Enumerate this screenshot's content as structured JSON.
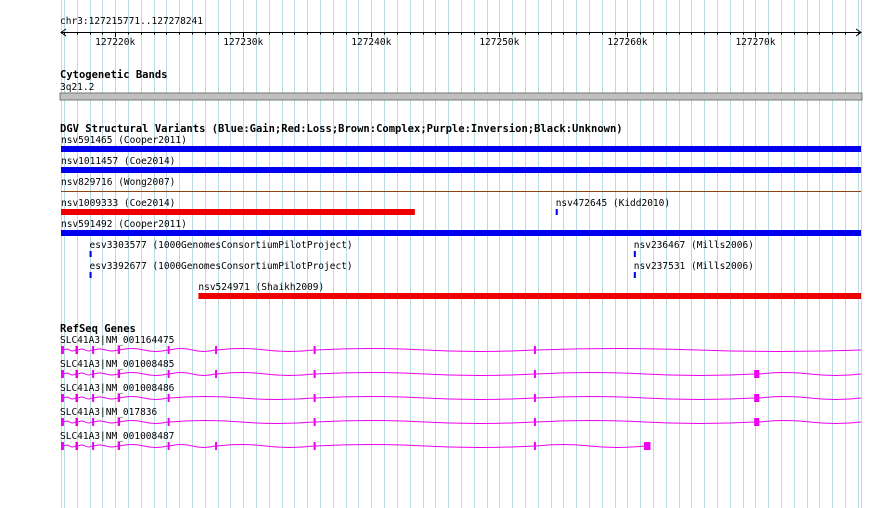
{
  "ruler": {
    "location": "chr3:127215771..127278241",
    "start": 127215771,
    "end": 127278241,
    "tick_labels": [
      "127220k",
      "127230k",
      "127240k",
      "127250k",
      "127260k",
      "127270k"
    ],
    "tick_values": [
      127220000,
      127230000,
      127240000,
      127250000,
      127260000,
      127270000
    ]
  },
  "cytobands": {
    "title": "Cytogenetic Bands",
    "band": "3q21.2"
  },
  "dgv": {
    "title": "DGV Structural Variants (Blue:Gain;Red:Loss;Brown:Complex;Purple:Inversion;Black:Unknown)",
    "colors": {
      "gain": "#0000ee",
      "loss": "#ee0000",
      "complex": "#8b4513",
      "inversion": "#800080",
      "unknown": "#000000"
    },
    "features": [
      {
        "label": "nsv591465 (Cooper2011)",
        "type": "gain",
        "start": 127215771,
        "end": 127278241,
        "row": 0
      },
      {
        "label": "nsv1011457 (Coe2014)",
        "type": "gain",
        "start": 127215771,
        "end": 127278241,
        "row": 1
      },
      {
        "label": "nsv829716 (Wong2007)",
        "type": "complex",
        "start": 127215771,
        "end": 127278241,
        "row": 2
      },
      {
        "label": "nsv1009333 (Coe2014)",
        "type": "loss",
        "start": 127215771,
        "end": 127243400,
        "row": 3
      },
      {
        "label": "nsv472645 (Kidd2010)",
        "type": "gain",
        "start": 127254400,
        "end": 127254560,
        "row": 3
      },
      {
        "label": "nsv591492 (Cooper2011)",
        "type": "gain",
        "start": 127215771,
        "end": 127278241,
        "row": 4
      },
      {
        "label": "esv3303577 (1000GenomesConsortiumPilotProject)",
        "type": "gain",
        "start": 127218000,
        "end": 127218160,
        "row": 5
      },
      {
        "label": "nsv236467 (Mills2006)",
        "type": "gain",
        "start": 127260500,
        "end": 127260660,
        "row": 5
      },
      {
        "label": "esv3392677 (1000GenomesConsortiumPilotProject)",
        "type": "gain",
        "start": 127218000,
        "end": 127218160,
        "row": 6
      },
      {
        "label": "nsv237531 (Mills2006)",
        "type": "gain",
        "start": 127260500,
        "end": 127260660,
        "row": 6
      },
      {
        "label": "nsv524971 (Shaikh2009)",
        "type": "loss",
        "start": 127226500,
        "end": 127278241,
        "row": 7
      }
    ]
  },
  "refseq": {
    "title": "RefSeq Genes",
    "color": "#ee00ee",
    "transcripts": [
      {
        "label": "SLC41A3|NM_001164475",
        "end": 127278241,
        "exons": [
          [
            127215771,
            127216000
          ],
          [
            127216900,
            127217100
          ],
          [
            127218200,
            127218350
          ],
          [
            127220200,
            127220380
          ],
          [
            127224100,
            127224250
          ],
          [
            127227800,
            127227950
          ],
          [
            127235500,
            127235650
          ],
          [
            127252700,
            127252850
          ]
        ]
      },
      {
        "label": "SLC41A3|NM_001008485",
        "end": 127278241,
        "exons": [
          [
            127215771,
            127216000
          ],
          [
            127216900,
            127217100
          ],
          [
            127218200,
            127218350
          ],
          [
            127220200,
            127220380
          ],
          [
            127224100,
            127224250
          ],
          [
            127227800,
            127227950
          ],
          [
            127235500,
            127235650
          ],
          [
            127252700,
            127252850
          ],
          [
            127269900,
            127270300
          ]
        ]
      },
      {
        "label": "SLC41A3|NM_001008486",
        "end": 127278241,
        "exons": [
          [
            127215771,
            127216000
          ],
          [
            127216900,
            127217100
          ],
          [
            127218200,
            127218350
          ],
          [
            127220200,
            127220380
          ],
          [
            127224100,
            127224250
          ],
          [
            127235500,
            127235650
          ],
          [
            127252700,
            127252850
          ],
          [
            127269900,
            127270300
          ]
        ]
      },
      {
        "label": "SLC41A3|NM_017836",
        "end": 127278241,
        "exons": [
          [
            127215771,
            127216000
          ],
          [
            127216900,
            127217100
          ],
          [
            127218200,
            127218350
          ],
          [
            127220200,
            127220380
          ],
          [
            127224100,
            127224250
          ],
          [
            127235500,
            127235650
          ],
          [
            127252700,
            127252850
          ],
          [
            127269900,
            127270300
          ]
        ]
      },
      {
        "label": "SLC41A3|NM_001008487",
        "end": 127261800,
        "exons": [
          [
            127215771,
            127216000
          ],
          [
            127216900,
            127217100
          ],
          [
            127218200,
            127218350
          ],
          [
            127220200,
            127220380
          ],
          [
            127224100,
            127224250
          ],
          [
            127227800,
            127227950
          ],
          [
            127235500,
            127235650
          ],
          [
            127252700,
            127252850
          ],
          [
            127261300,
            127261800
          ]
        ]
      }
    ]
  }
}
